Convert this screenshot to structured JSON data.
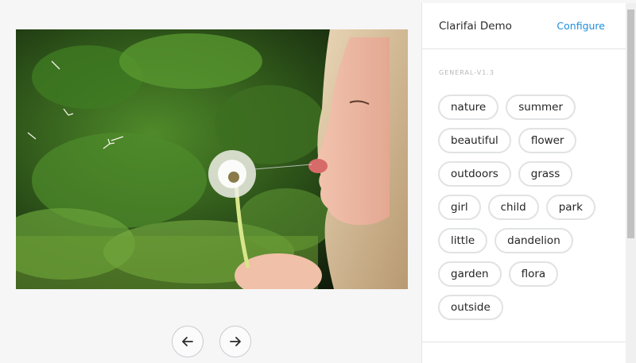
{
  "panel": {
    "title": "Clarifai Demo",
    "configure_label": "Configure",
    "model_label": "GENERAL-V1.3",
    "tags": [
      "nature",
      "summer",
      "beautiful",
      "flower",
      "outdoors",
      "grass",
      "girl",
      "child",
      "park",
      "little",
      "dandelion",
      "garden",
      "flora",
      "outside"
    ]
  },
  "navigation": {
    "prev_icon": "arrow-left-icon",
    "next_icon": "arrow-right-icon"
  },
  "colors": {
    "accent": "#1e8ddb",
    "tag_border": "#e1e2e4",
    "page_background": "#f6f6f7"
  }
}
